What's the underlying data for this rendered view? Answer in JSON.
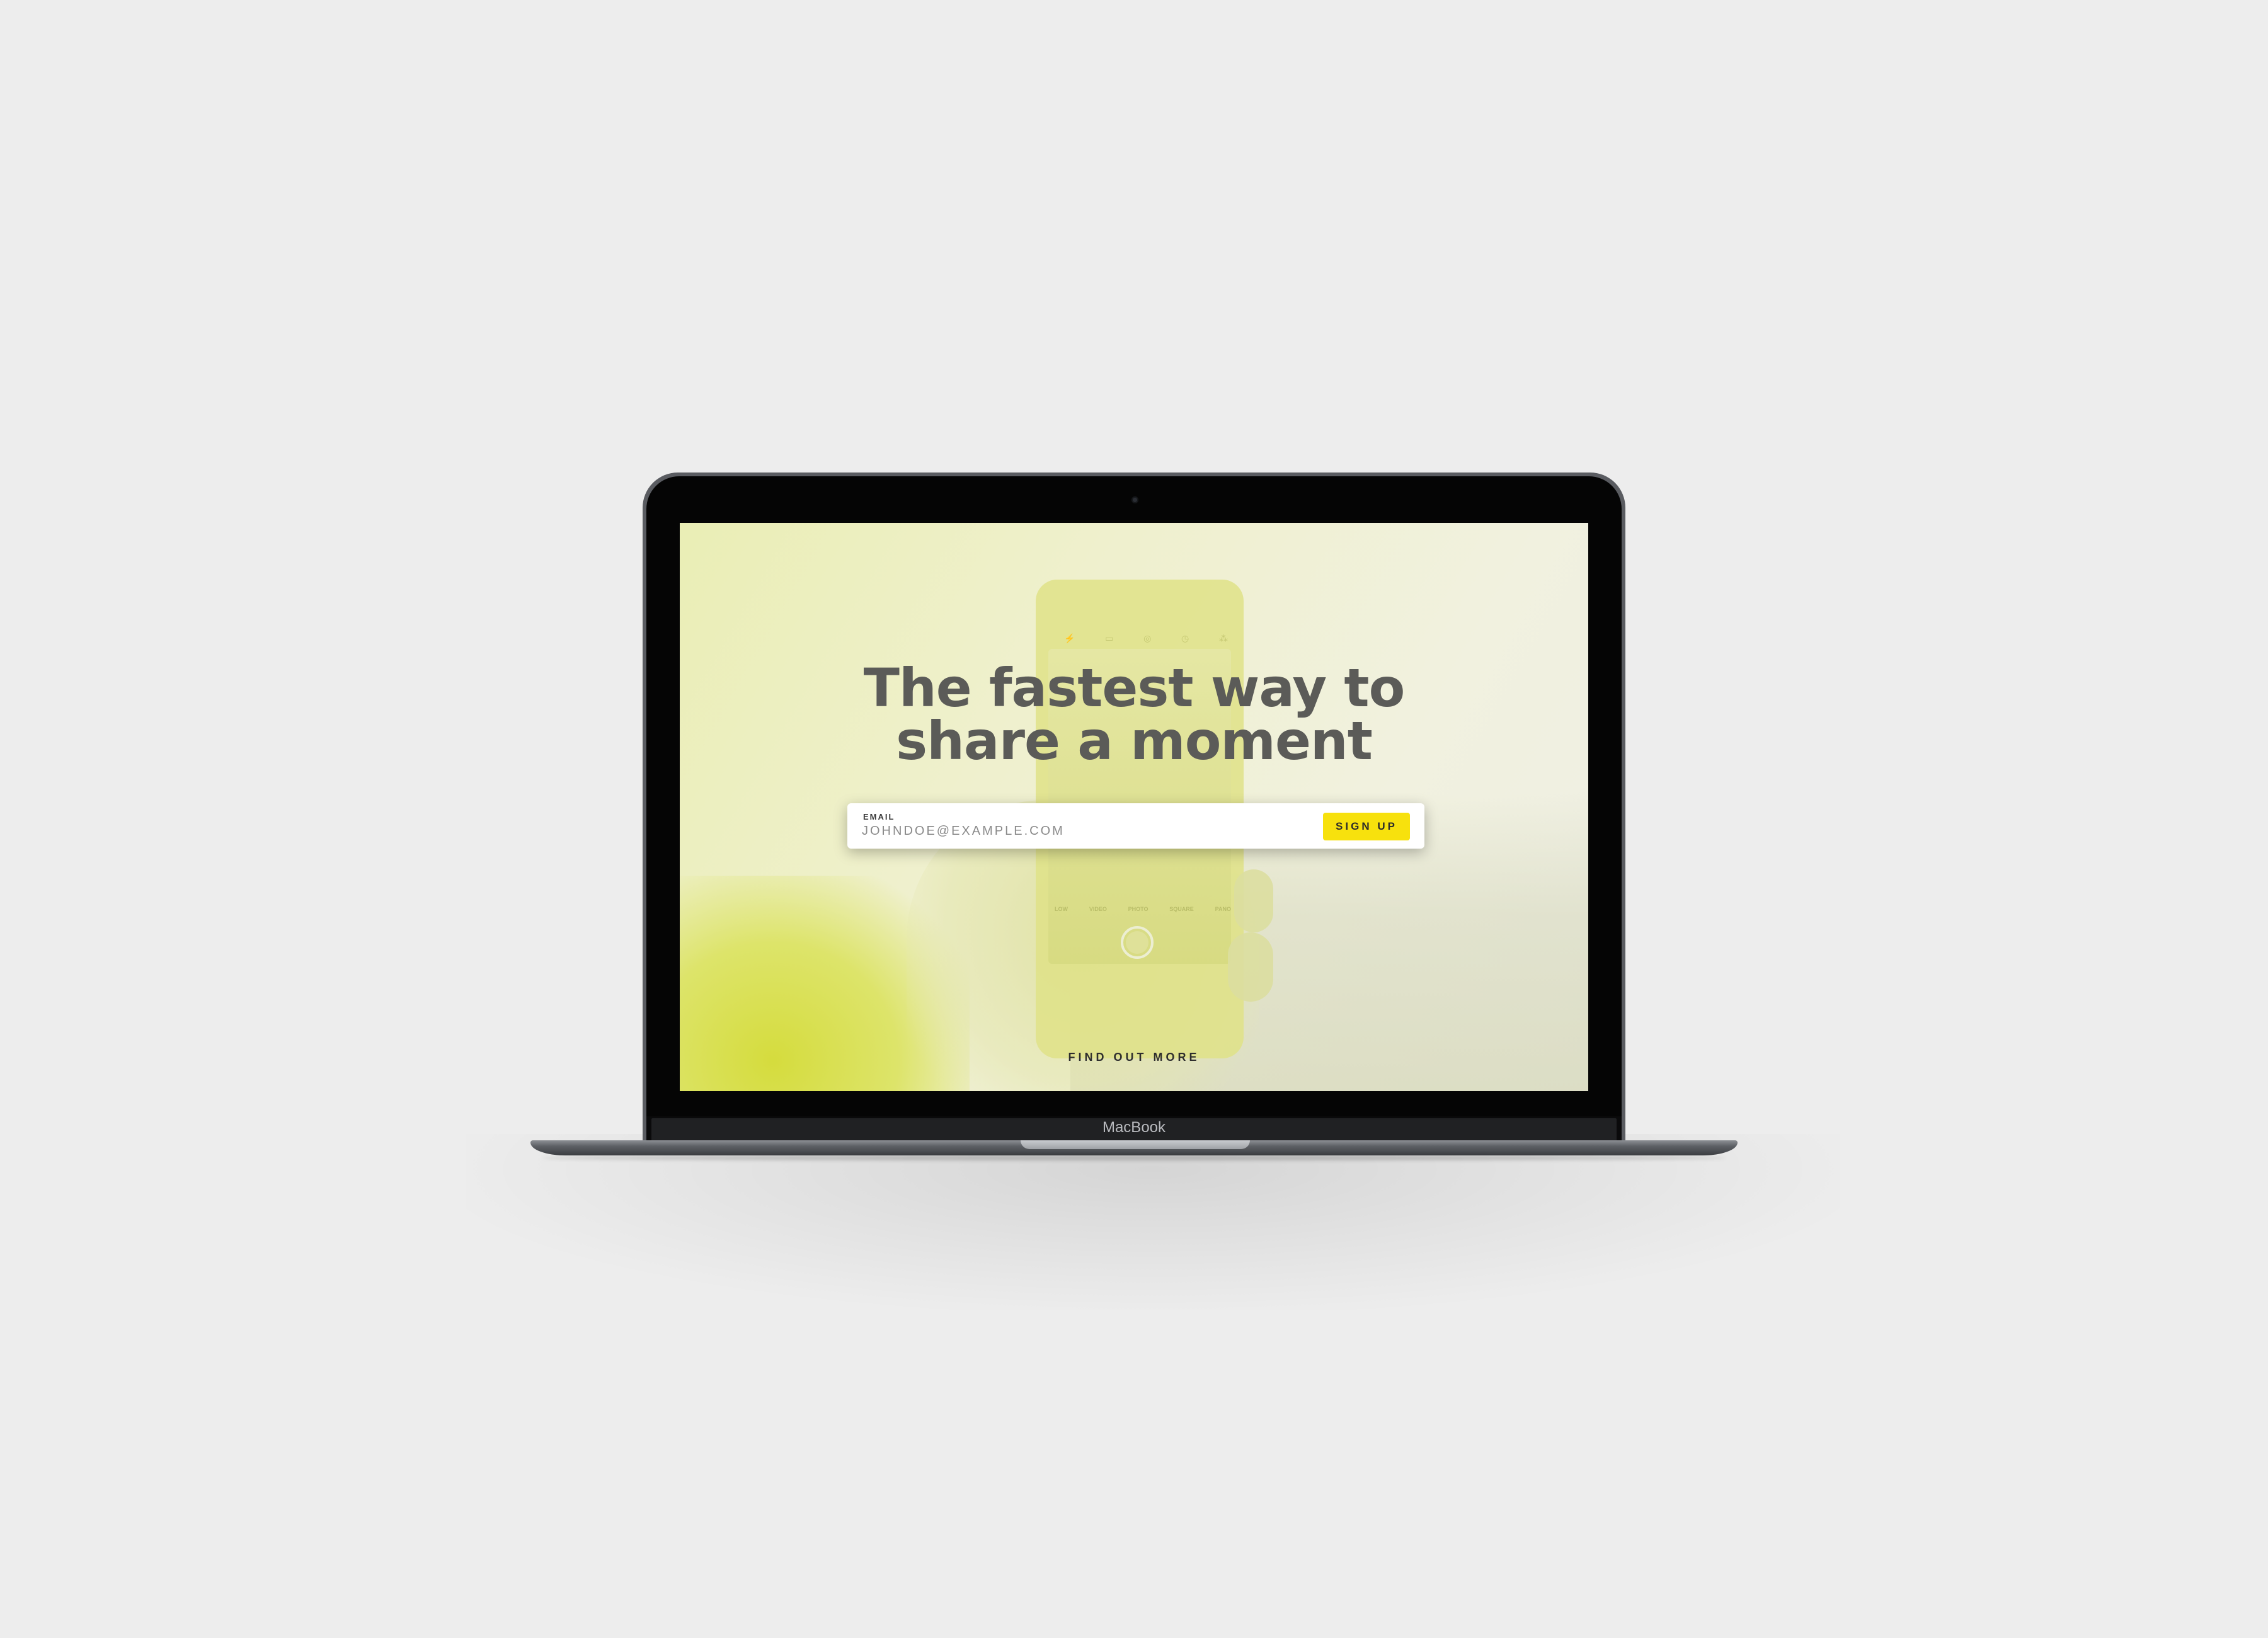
{
  "hero": {
    "headline_line1": "The fastest way to",
    "headline_line2": "share a moment"
  },
  "signup_form": {
    "email_label": "EMAIL",
    "email_placeholder": "JOHNDOE@EXAMPLE.COM",
    "email_value": "",
    "button_label": "SIGN UP"
  },
  "footer_link": {
    "label": "FIND OUT MORE"
  },
  "device": {
    "brand": "MacBook"
  },
  "phone_camera_modes": [
    "LOW",
    "VIDEO",
    "PHOTO",
    "SQUARE",
    "PANO"
  ],
  "colors": {
    "accent_yellow": "#f7e10d",
    "headline_grey": "#5b5b58",
    "page_background": "#ededed"
  }
}
